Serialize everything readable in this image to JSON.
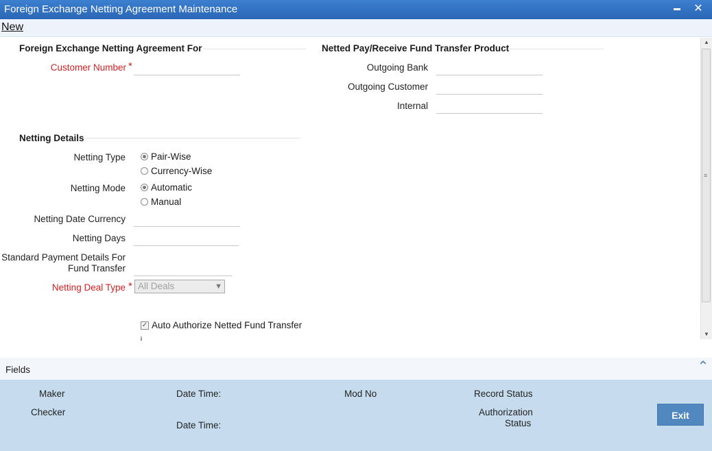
{
  "window": {
    "title": "Foreign Exchange Netting Agreement Maintenance",
    "minimize": "▬",
    "close": "✕"
  },
  "menu": {
    "new_label": "New"
  },
  "section_agreement": {
    "title": "Foreign Exchange Netting Agreement For",
    "customer_number_label": "Customer Number",
    "customer_number_value": ""
  },
  "section_fund_transfer": {
    "title": "Netted Pay/Receive Fund Transfer Product",
    "outgoing_bank_label": "Outgoing Bank",
    "outgoing_bank_value": "",
    "outgoing_customer_label": "Outgoing Customer",
    "outgoing_customer_value": "",
    "internal_label": "Internal",
    "internal_value": ""
  },
  "section_netting": {
    "title": "Netting Details",
    "netting_type_label": "Netting Type",
    "netting_type_options": [
      "Pair-Wise",
      "Currency-Wise"
    ],
    "netting_type_selected": "Pair-Wise",
    "netting_mode_label": "Netting Mode",
    "netting_mode_options": [
      "Automatic",
      "Manual"
    ],
    "netting_mode_selected": "Automatic",
    "netting_date_currency_label": "Netting Date Currency",
    "netting_days_label": "Netting Days",
    "standard_payment_label_line1": "Standard Payment Details For",
    "standard_payment_label_line2": "Fund Transfer",
    "netting_deal_type_label": "Netting Deal Type",
    "netting_deal_type_value": "All Deals",
    "auto_authorize_label": "Auto Authorize Netted Fund Transfer",
    "auto_authorize_checked": true
  },
  "required_mark": "*",
  "footer": {
    "fields_label": "Fields",
    "maker_label": "Maker",
    "checker_label": "Checker",
    "date_time_label": "Date Time:",
    "mod_no_label": "Mod No",
    "record_status_label": "Record Status",
    "authorization_status_line1": "Authorization",
    "authorization_status_line2": "Status",
    "exit_label": "Exit"
  },
  "colors": {
    "title_bar": "#2f72c6",
    "required": "#d42020",
    "audit_bg": "#c6dcee",
    "exit_button": "#5088bf"
  }
}
